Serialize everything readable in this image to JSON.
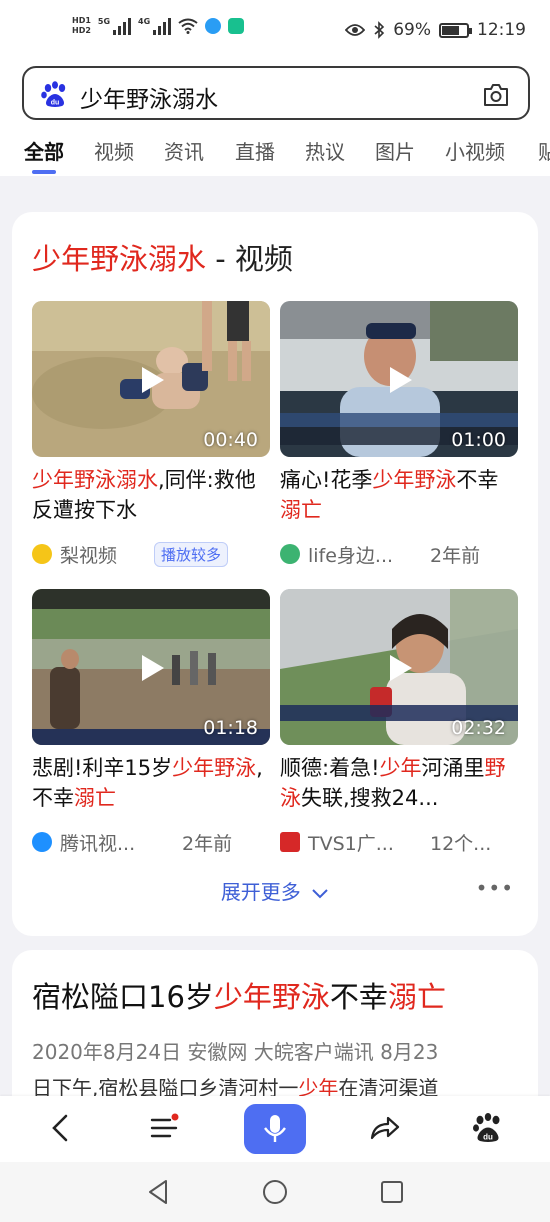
{
  "status_bar": {
    "hd1": "HD1",
    "hd2": "HD2",
    "net1": "5G",
    "net2": "4G",
    "battery_percent": "69%",
    "battery_level": 0.69,
    "time": "12:19"
  },
  "search": {
    "query": "少年野泳溺水",
    "logo_icon": "baidu-paw-icon",
    "camera_icon": "camera-icon"
  },
  "tabs": [
    "全部",
    "视频",
    "资讯",
    "直播",
    "热议",
    "图片",
    "小视频",
    "贴"
  ],
  "active_tab": "全部",
  "video_section": {
    "title_keyword": "少年野泳溺水",
    "title_suffix": " - 视频",
    "videos": [
      {
        "duration": "00:40",
        "title_parts": [
          {
            "t": "少年野泳溺水",
            "hl": true
          },
          {
            "t": ",同伴:救他反遭按下水",
            "hl": false
          }
        ],
        "source": "梨视频",
        "source_icon_color": "#f5c518",
        "badge": "播放较多",
        "age": ""
      },
      {
        "duration": "01:00",
        "title_parts": [
          {
            "t": "痛心!花季",
            "hl": false
          },
          {
            "t": "少年野泳",
            "hl": true
          },
          {
            "t": "不幸",
            "hl": false
          },
          {
            "t": "溺亡",
            "hl": true
          }
        ],
        "source": "life身边...",
        "source_icon_color": "#3cb371",
        "badge": "",
        "age": "2年前"
      },
      {
        "duration": "01:18",
        "title_parts": [
          {
            "t": "悲剧!利辛15岁",
            "hl": false
          },
          {
            "t": "少年野泳",
            "hl": true
          },
          {
            "t": ",不幸",
            "hl": false
          },
          {
            "t": "溺亡",
            "hl": true
          }
        ],
        "source": "腾讯视...",
        "source_icon_color": "#1e90ff",
        "badge": "",
        "age": "2年前"
      },
      {
        "duration": "02:32",
        "title_parts": [
          {
            "t": "顺德:着急!",
            "hl": false
          },
          {
            "t": "少年",
            "hl": true
          },
          {
            "t": "河涌里",
            "hl": false
          },
          {
            "t": "野泳",
            "hl": true
          },
          {
            "t": "失联,搜救24...",
            "hl": false
          }
        ],
        "source": "TVS1广...",
        "source_icon_color": "#d62828",
        "badge": "",
        "age": "12个..."
      }
    ],
    "expand_more": "展开更多",
    "more_icon": "ellipsis-icon"
  },
  "article": {
    "title_parts": [
      {
        "t": "宿松隘口16岁",
        "hl": false
      },
      {
        "t": "少年野泳",
        "hl": true
      },
      {
        "t": "不幸",
        "hl": false
      },
      {
        "t": "溺亡",
        "hl": true
      }
    ],
    "meta": "2020年8月24日  安徽网 大皖客户端讯 8月23",
    "body_parts": [
      {
        "t": "日下午,宿松县隘口乡清河村一",
        "hl": false
      },
      {
        "t": "少年",
        "hl": true
      },
      {
        "t": "在清河渠道",
        "hl": false
      }
    ]
  },
  "bottom_bar": {
    "icons": [
      "back-icon",
      "menu-icon",
      "mic-icon",
      "share-icon",
      "baidu-home-icon"
    ],
    "accent": "#4e6ef2"
  },
  "nav_bar": {
    "icons": [
      "nav-back-icon",
      "nav-home-icon",
      "nav-recents-icon"
    ]
  },
  "colors": {
    "highlight": "#e0281e",
    "accent": "#4e6ef2",
    "link": "#3e5fd6"
  }
}
